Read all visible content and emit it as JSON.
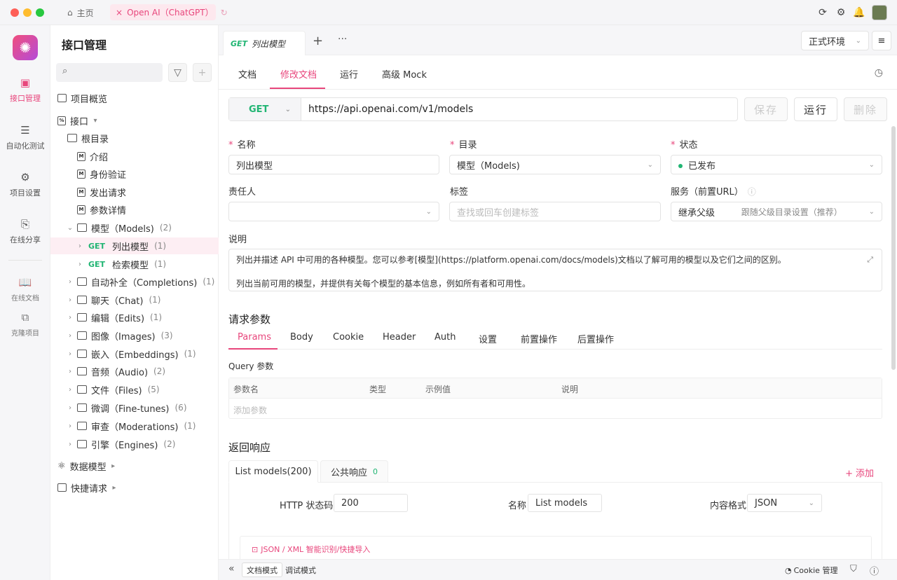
{
  "titlebar": {
    "home_tab": "主页",
    "open_tab": "Open AI（ChatGPT）"
  },
  "leftnav": [
    {
      "label": "接口管理",
      "icon": "api-icon",
      "active": true
    },
    {
      "label": "自动化测试",
      "icon": "automation-icon",
      "active": false
    },
    {
      "label": "项目设置",
      "icon": "settings-icon",
      "active": false
    },
    {
      "label": "在线分享",
      "icon": "share-icon",
      "active": false
    },
    {
      "label": "在线文档",
      "icon": "book-icon",
      "active": false
    },
    {
      "label": "克隆项目",
      "icon": "clone-icon",
      "active": false
    }
  ],
  "sidebar": {
    "title": "接口管理",
    "overview": "项目概览",
    "interfaces": "接口",
    "root": "根目录",
    "docs": [
      "介绍",
      "身份验证",
      "发出请求",
      "参数详情"
    ],
    "models_folder": {
      "label": "模型（Models)",
      "count": "(2)"
    },
    "endpoints": [
      {
        "method": "GET",
        "label": "列出模型",
        "count": "(1)"
      },
      {
        "method": "GET",
        "label": "检索模型",
        "count": "(1)"
      }
    ],
    "folders": [
      {
        "label": "自动补全（Completions)",
        "count": "(1)"
      },
      {
        "label": "聊天（Chat)",
        "count": "(1)"
      },
      {
        "label": "编辑（Edits)",
        "count": "(1)"
      },
      {
        "label": "图像（Images)",
        "count": "(3)"
      },
      {
        "label": "嵌入（Embeddings)",
        "count": "(1)"
      },
      {
        "label": "音频（Audio)",
        "count": "(2)"
      },
      {
        "label": "文件（Files)",
        "count": "(5)"
      },
      {
        "label": "微调（Fine-tunes)",
        "count": "(6)"
      },
      {
        "label": "审查（Moderations)",
        "count": "(1)"
      },
      {
        "label": "引擎（Engines)",
        "count": "(2)"
      }
    ],
    "data_models": "数据模型",
    "quick_requests": "快捷请求"
  },
  "doc_tab": {
    "method": "GET",
    "title": "列出模型"
  },
  "env": "正式环境",
  "subtabs": [
    "文档",
    "修改文档",
    "运行",
    "高级 Mock"
  ],
  "request": {
    "method": "GET",
    "url": "https://api.openai.com/v1/models",
    "save": "保存",
    "run": "运行",
    "delete": "删除"
  },
  "form": {
    "name_label": "名称",
    "name_value": "列出模型",
    "dir_label": "目录",
    "dir_value": "模型（Models)",
    "status_label": "状态",
    "status_value": "已发布",
    "owner_label": "责任人",
    "tags_label": "标签",
    "tags_placeholder": "查找或回车创建标签",
    "service_label": "服务（前置URL）",
    "service_value": "继承父级",
    "service_hint": "跟随父级目录设置（推荐）",
    "desc_label": "说明",
    "desc_line1": "列出并描述 API 中可用的各种模型。您可以参考[模型](https://platform.openai.com/docs/models)文档以了解可用的模型以及它们之间的区别。",
    "desc_line2": "列出当前可用的模型，并提供有关每个模型的基本信息，例如所有者和可用性。"
  },
  "params": {
    "title": "请求参数",
    "tabs": [
      "Params",
      "Body",
      "Cookie",
      "Header",
      "Auth",
      "设置",
      "前置操作",
      "后置操作"
    ],
    "query_title": "Query 参数",
    "columns": [
      "参数名",
      "类型",
      "示例值",
      "说明"
    ],
    "add_placeholder": "添加参数"
  },
  "response": {
    "title": "返回响应",
    "tab1": "List models(200)",
    "tab2": "公共响应",
    "tab2_count": "0",
    "add": "添加",
    "http_label": "HTTP 状态码",
    "http_value": "200",
    "name_label": "名称",
    "name_value": "List models",
    "format_label": "内容格式",
    "format_value": "JSON",
    "import": "JSON / XML 智能识别/快捷导入"
  },
  "bottom": {
    "doc_mode": "文档模式",
    "debug_mode": "调试模式",
    "cookie": "Cookie 管理"
  }
}
